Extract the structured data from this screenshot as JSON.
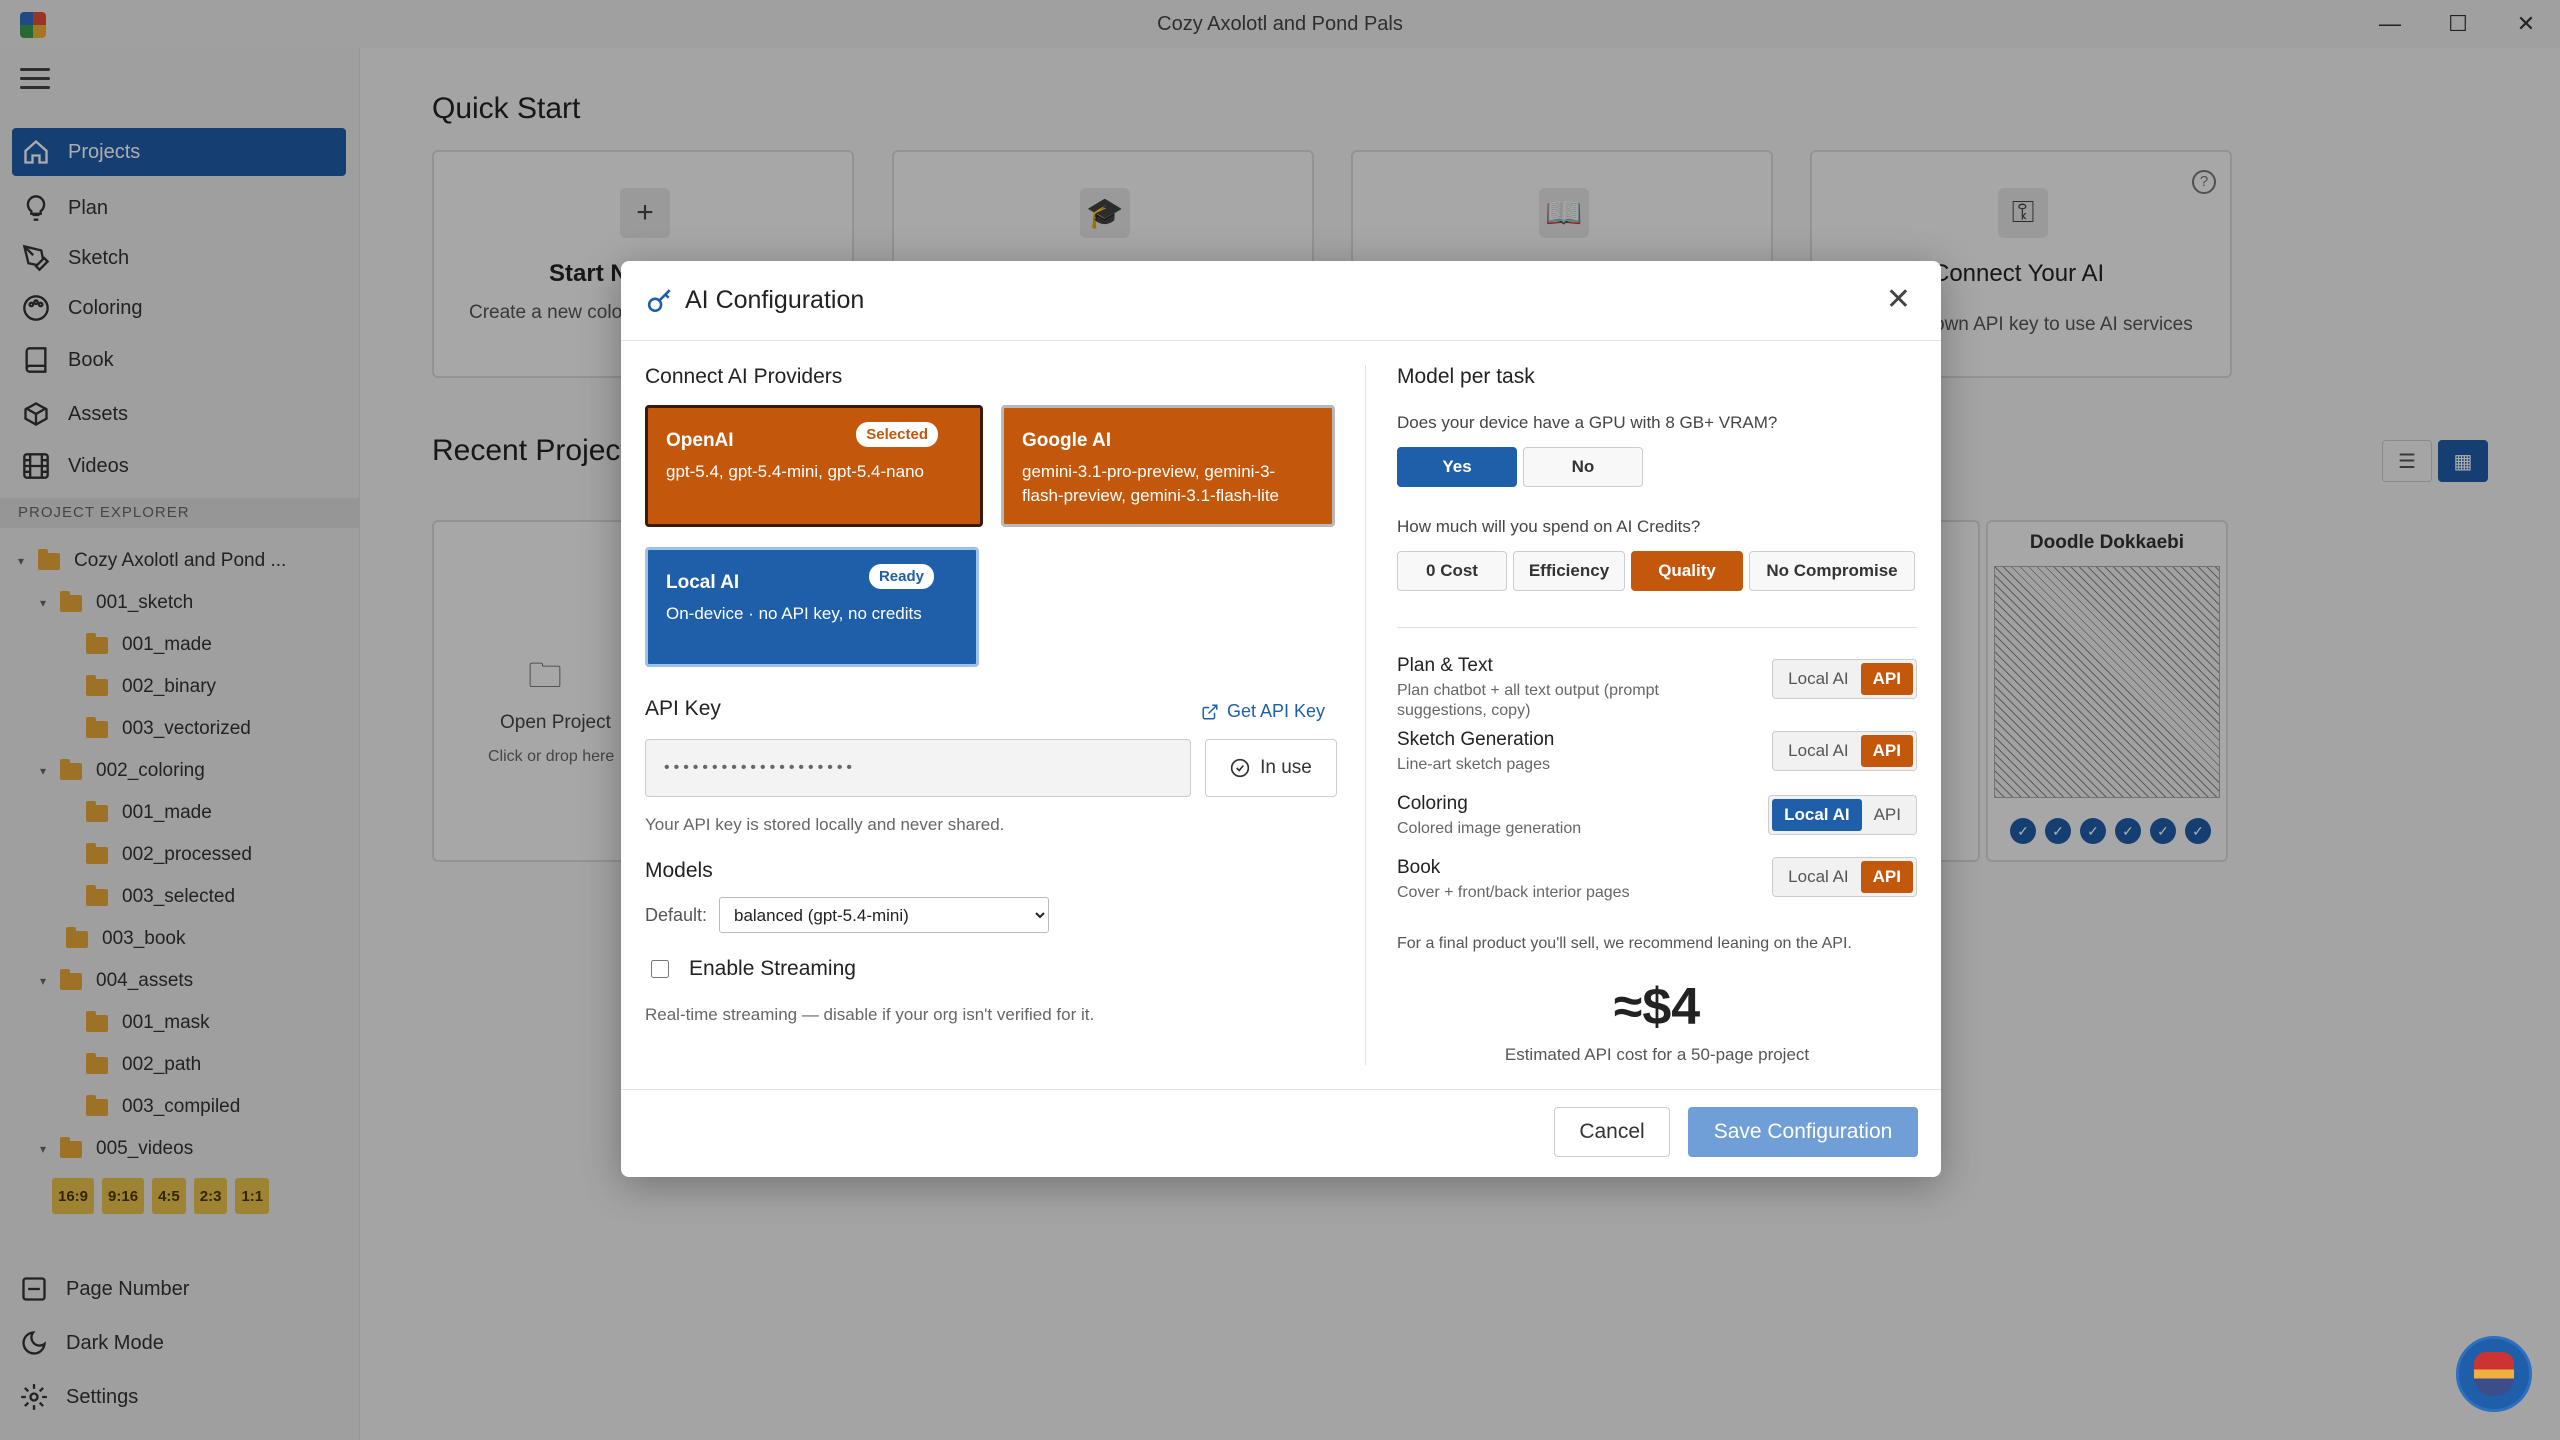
{
  "window": {
    "title": "Cozy Axolotl and Pond Pals",
    "minimize": "—",
    "maximize": "☐",
    "close": "✕"
  },
  "sidebar": {
    "nav": [
      {
        "label": "Projects",
        "icon": "home-icon"
      },
      {
        "label": "Plan",
        "icon": "lightbulb-icon"
      },
      {
        "label": "Sketch",
        "icon": "pen-icon"
      },
      {
        "label": "Coloring",
        "icon": "palette-icon"
      },
      {
        "label": "Book",
        "icon": "book-icon"
      },
      {
        "label": "Assets",
        "icon": "box-icon"
      },
      {
        "label": "Videos",
        "icon": "film-icon"
      }
    ],
    "explorer_heading": "PROJECT EXPLORER",
    "tree": [
      {
        "label": "Cozy Axolotl and Pond ...",
        "caret": "▾"
      },
      {
        "label": "001_sketch",
        "caret": "▾"
      },
      {
        "label": "001_made"
      },
      {
        "label": "002_binary"
      },
      {
        "label": "003_vectorized"
      },
      {
        "label": "002_coloring",
        "caret": "▾"
      },
      {
        "label": "001_made"
      },
      {
        "label": "002_processed"
      },
      {
        "label": "003_selected"
      },
      {
        "label": "003_book"
      },
      {
        "label": "004_assets",
        "caret": "▾"
      },
      {
        "label": "001_mask"
      },
      {
        "label": "002_path"
      },
      {
        "label": "003_compiled"
      },
      {
        "label": "005_videos",
        "caret": "▾"
      }
    ],
    "ratios": [
      "16:9",
      "9:16",
      "4:5",
      "2:3",
      "1:1"
    ],
    "bottom": [
      {
        "label": "Page Number",
        "icon": "page-number-icon"
      },
      {
        "label": "Dark Mode",
        "icon": "moon-icon"
      },
      {
        "label": "Settings",
        "icon": "gear-icon"
      }
    ]
  },
  "main": {
    "quick_start_title": "Quick Start",
    "quick_cards": [
      {
        "icon": "plus-icon",
        "title": "Start N",
        "subtitle": "Create a new colo"
      },
      {
        "icon": "graduation-cap-icon",
        "title": "",
        "subtitle": ""
      },
      {
        "icon": "open-book-icon",
        "title": "",
        "subtitle": ""
      },
      {
        "icon": "key-icon",
        "title": "Connect Your AI",
        "subtitle": "own API key to use AI services"
      }
    ],
    "recent_title": "Recent Project",
    "open_project": {
      "title": "Open Project",
      "subtitle": "Click or drop here"
    },
    "project_card": {
      "name": "Doodle Dokkaebi",
      "checks": 6
    }
  },
  "dialog": {
    "title": "AI Configuration",
    "close": "✕",
    "providers_heading": "Connect AI Providers",
    "providers": {
      "openai": {
        "name": "OpenAI",
        "badge": "Selected",
        "models": "gpt-5.4, gpt-5.4-mini, gpt-5.4-nano"
      },
      "google": {
        "name": "Google AI",
        "models": "gemini-3.1-pro-preview, gemini-3-flash-preview, gemini-3.1-flash-lite"
      },
      "local": {
        "name": "Local AI",
        "badge": "Ready",
        "models": "On-device · no API key, no credits"
      }
    },
    "api_key": {
      "label": "API Key",
      "get_link": "Get API Key",
      "value": "••••••••••••••••••••",
      "in_use": "In use",
      "note": "Your API key is stored locally and never shared."
    },
    "models": {
      "label": "Models",
      "default_label": "Default:",
      "default_value": "balanced (gpt-5.4-mini)"
    },
    "streaming": {
      "label": "Enable Streaming",
      "note": "Real-time streaming — disable if your org isn't verified for it."
    },
    "right": {
      "heading": "Model per task",
      "gpu_question": "Does your device have a GPU with 8 GB+ VRAM?",
      "gpu_options": [
        "Yes",
        "No"
      ],
      "gpu_selected": "Yes",
      "spend_question": "How much will you spend on AI Credits?",
      "spend_options": [
        "0 Cost",
        "Efficiency",
        "Quality",
        "No Compromise"
      ],
      "spend_selected": "Quality",
      "tasks": [
        {
          "name": "Plan & Text",
          "desc": "Plan chatbot + all text output (prompt suggestions, copy)",
          "local": "Local AI",
          "api": "API",
          "selected": "API"
        },
        {
          "name": "Sketch Generation",
          "desc": "Line-art sketch pages",
          "local": "Local AI",
          "api": "API",
          "selected": "API"
        },
        {
          "name": "Coloring",
          "desc": "Colored image generation",
          "local": "Local AI",
          "api": "API",
          "selected": "Local AI"
        },
        {
          "name": "Book",
          "desc": "Cover + front/back interior pages",
          "local": "Local AI",
          "api": "API",
          "selected": "API"
        }
      ],
      "recommend": "For a final product you'll sell, we recommend leaning on the API.",
      "cost": "≈$4",
      "cost_note": "Estimated API cost for a 50-page project"
    },
    "cancel": "Cancel",
    "save": "Save Configuration"
  },
  "colors": {
    "accent_blue": "#1f5ea8",
    "accent_orange": "#c3580c",
    "folder": "#e8a93a",
    "ratio": "#e9c24a"
  }
}
